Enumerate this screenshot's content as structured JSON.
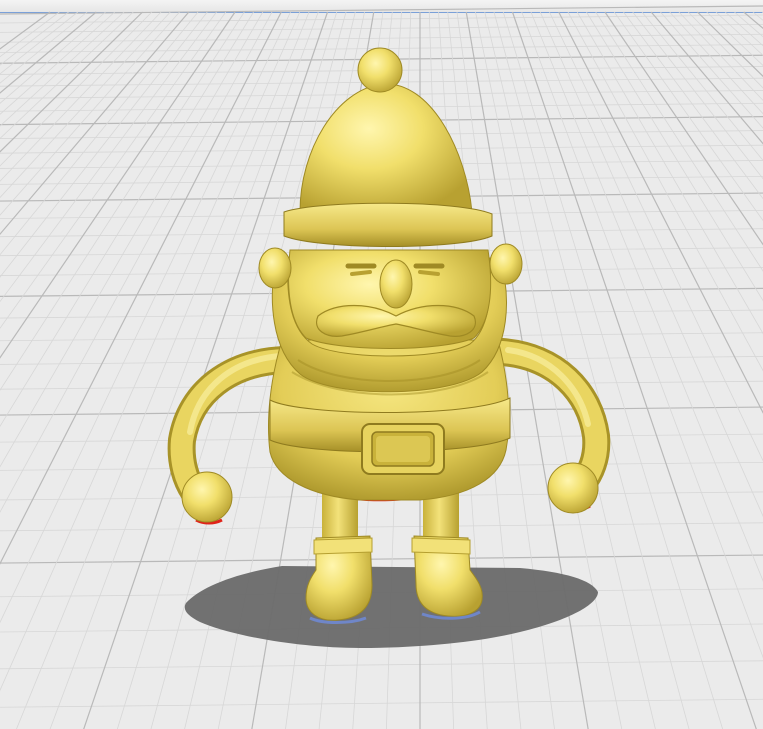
{
  "viewport": {
    "label": "",
    "model_name": "santa-gnome"
  },
  "colors": {
    "background": "#ebebeb",
    "grid_minor": "#d7d7d7",
    "grid_major": "#b9b9b9",
    "model_fill": "#f0df6a",
    "model_highlight": "#fff7b8",
    "model_shade": "#c9b23a",
    "model_dark": "#9f8a24",
    "shadow": "#6d6d6d",
    "overhang": "#e0241a",
    "selection_edge": "#7aa0d8"
  }
}
